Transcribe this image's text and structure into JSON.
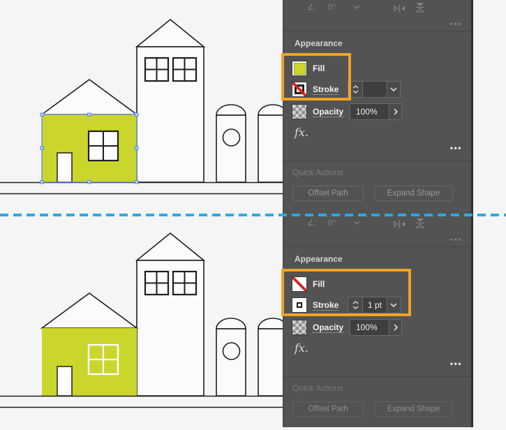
{
  "colors": {
    "fill_yellow": "#CAD62B",
    "highlight_orange": "#F2A321",
    "guide_blue": "#29ABE2",
    "selection_blue": "#5C87EE",
    "panel_bg": "#535353",
    "none_red": "#D9251D",
    "canvas_bg": "#F5F5F6",
    "line_dark": "#1F1F23"
  },
  "icons": {
    "ellipsis": "•••",
    "fx": "fx.",
    "angle_prefix": "∠:"
  },
  "panel_top": {
    "transform": {
      "angle_value": "0°"
    },
    "appearance": {
      "title": "Appearance",
      "fill_label": "Fill",
      "stroke_label": "Stroke",
      "stroke_weight": "",
      "opacity_label": "Opacity",
      "opacity_value": "100%"
    },
    "quick_actions": {
      "title": "Quick Actions",
      "offset_path": "Offset Path",
      "expand_shape": "Expand Shape"
    }
  },
  "panel_bottom": {
    "transform": {
      "angle_value": "0°"
    },
    "appearance": {
      "title": "Appearance",
      "fill_label": "Fill",
      "stroke_label": "Stroke",
      "stroke_weight": "1 pt",
      "opacity_label": "Opacity",
      "opacity_value": "100%"
    },
    "quick_actions": {
      "title": "Quick Actions",
      "offset_path": "Offset Path",
      "expand_shape": "Expand Shape"
    }
  }
}
